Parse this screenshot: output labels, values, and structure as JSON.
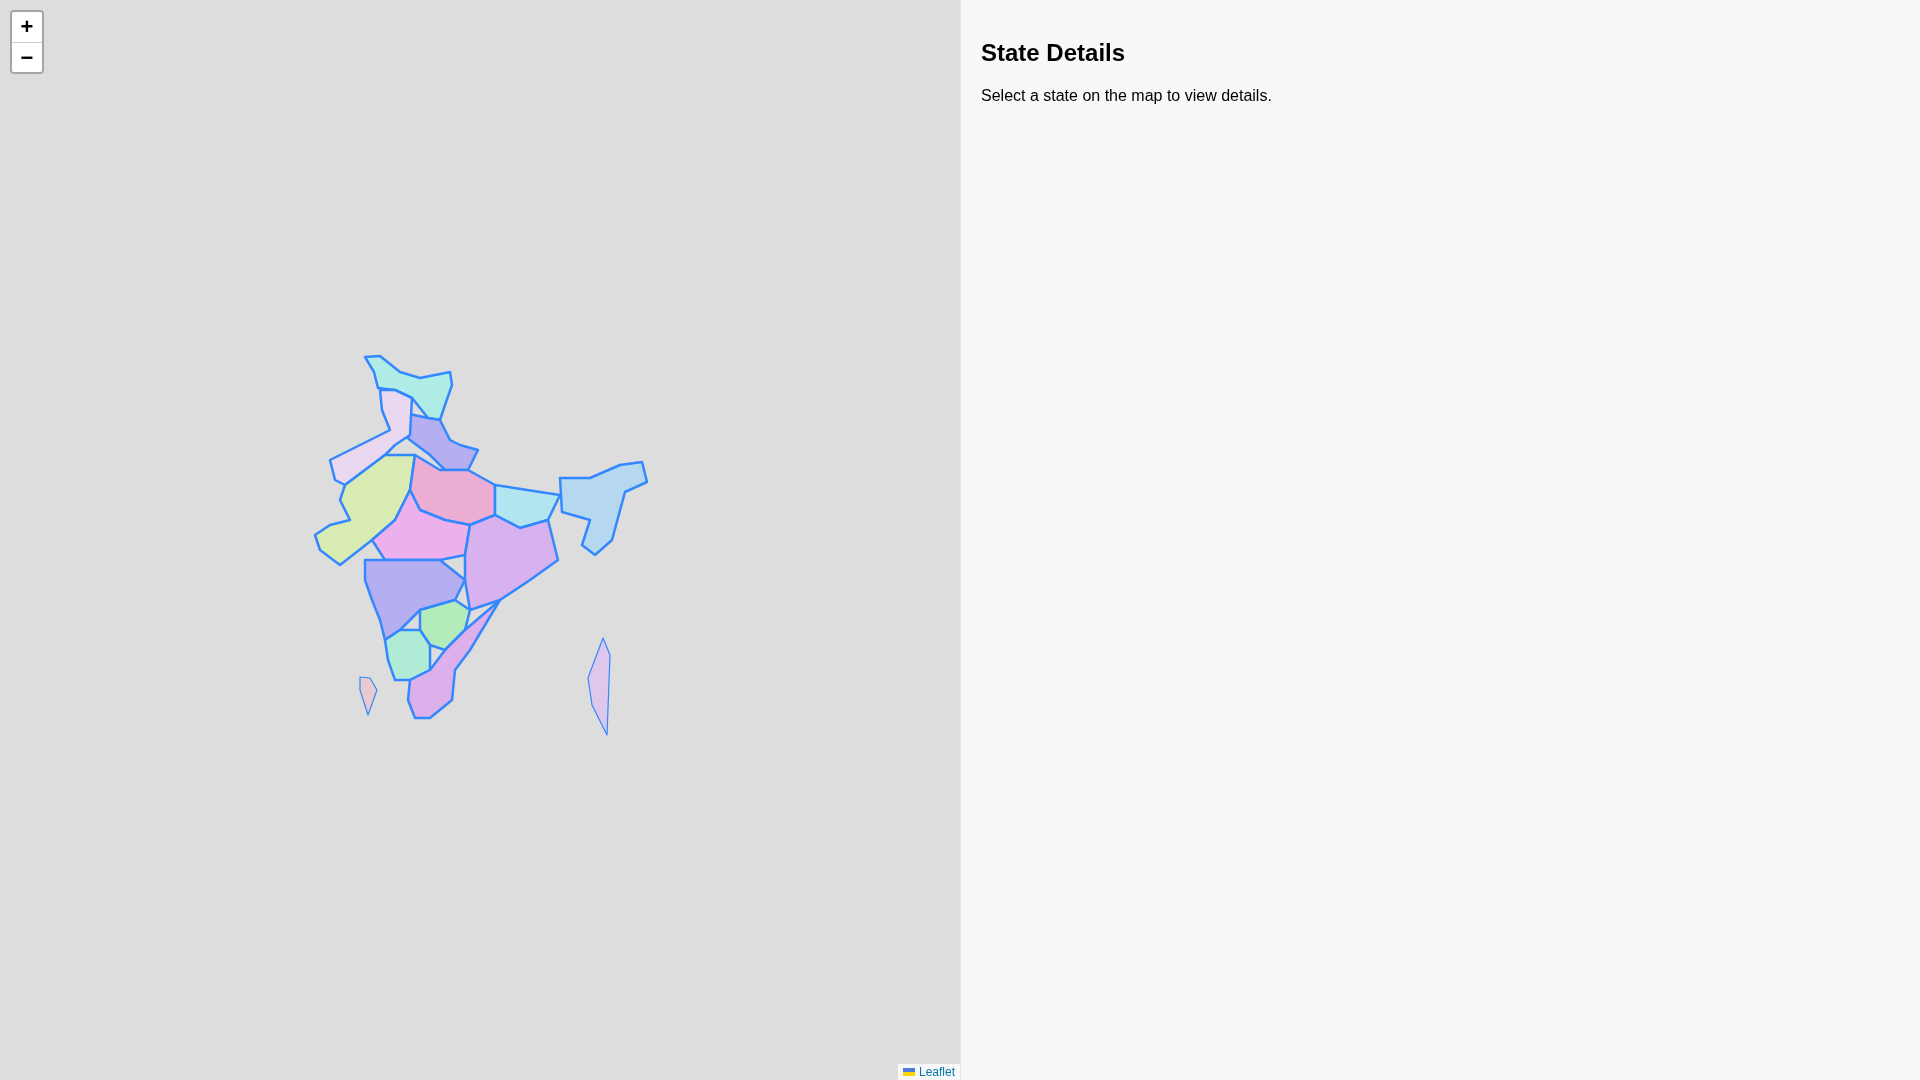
{
  "map": {
    "zoom_controls": [
      "+",
      "−"
    ],
    "attribution": "Leaflet"
  },
  "details_panel": {
    "title": "State Details",
    "message": "Select a state on the map to view details."
  }
}
